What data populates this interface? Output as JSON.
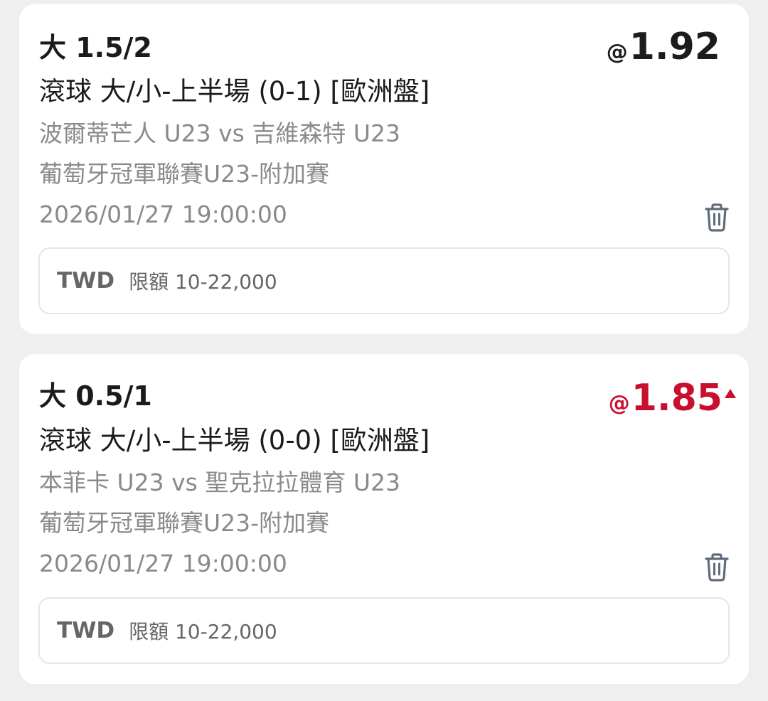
{
  "colors": {
    "page_background": "#efefef",
    "card_background": "#ffffff",
    "odds_up": "#c8102e",
    "text_primary": "#1b1b1b",
    "text_secondary": "#8a8a8a",
    "icon": "#5f6b7a"
  },
  "bets": [
    {
      "selection": "大 1.5/2",
      "odds_prefix": "@",
      "odds": "1.92",
      "odds_trend": "none",
      "market": "滾球 大/小-上半場  (0-1) [歐洲盤]",
      "match": "波爾蒂芒人 U23 vs 吉維森特 U23",
      "league": "葡萄牙冠軍聯賽U23-附加賽",
      "datetime": "2026/01/27 19:00:00",
      "delete_icon": "trash-icon",
      "currency": "TWD",
      "limit": "限額 10-22,000"
    },
    {
      "selection": "大 0.5/1",
      "odds_prefix": "@",
      "odds": "1.85",
      "odds_trend": "up",
      "trend_icon": "arrow-up-icon",
      "market": "滾球 大/小-上半場  (0-0) [歐洲盤]",
      "match": "本菲卡 U23 vs 聖克拉拉體育 U23",
      "league": "葡萄牙冠軍聯賽U23-附加賽",
      "datetime": "2026/01/27 19:00:00",
      "delete_icon": "trash-icon",
      "currency": "TWD",
      "limit": "限額 10-22,000"
    }
  ]
}
